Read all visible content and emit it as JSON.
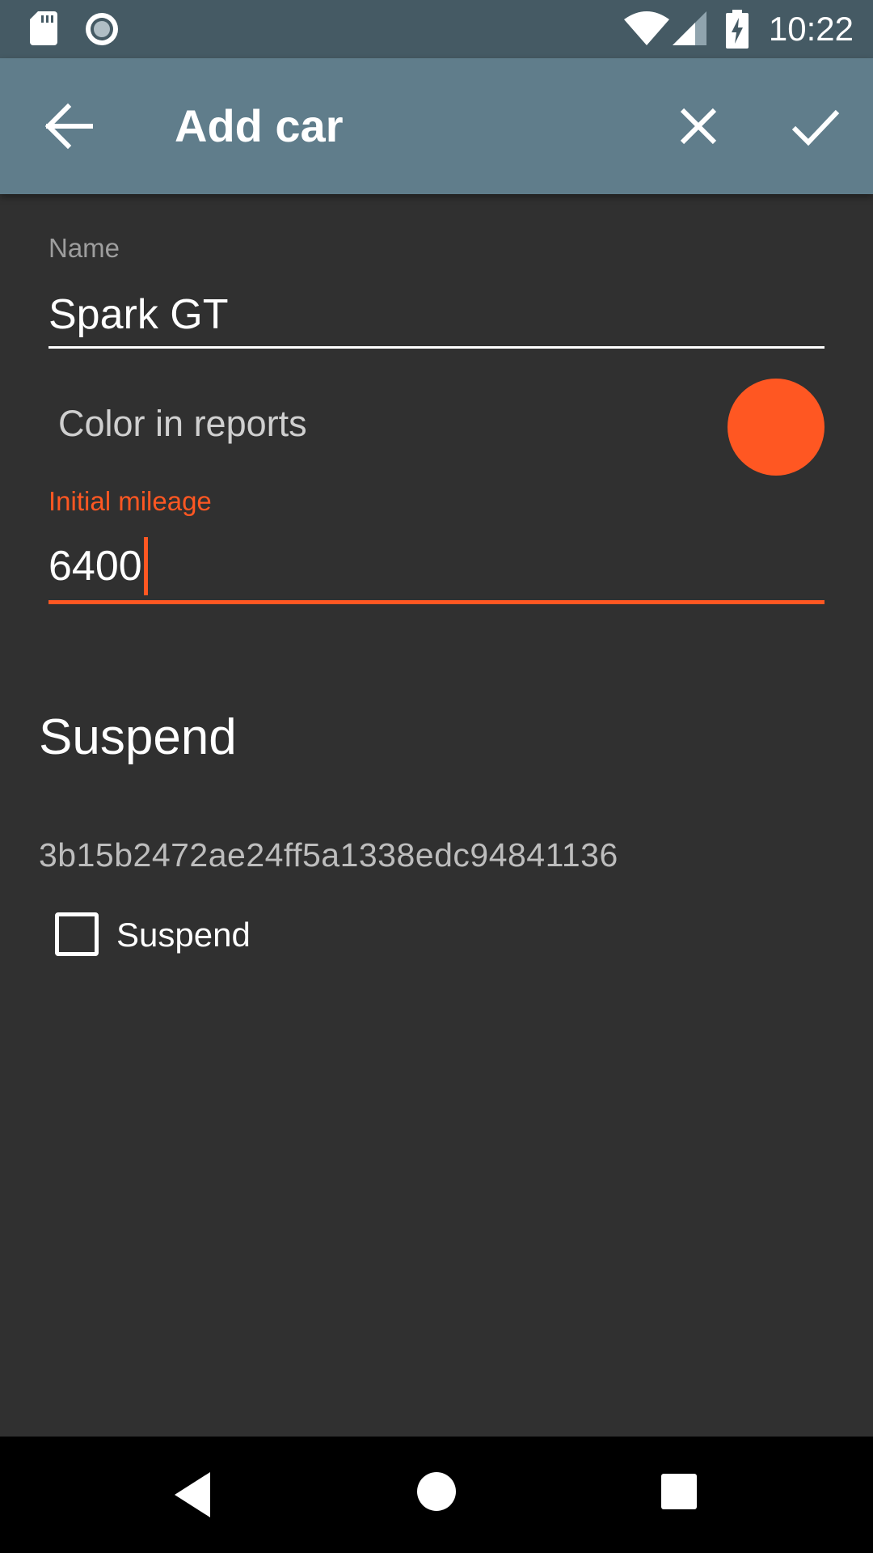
{
  "status_bar": {
    "time": "10:22",
    "icons": [
      "sd-card-icon",
      "sync-icon",
      "wifi-icon",
      "signal-icon",
      "battery-charging-icon"
    ]
  },
  "app_bar": {
    "title": "Add car",
    "icons": [
      "back-arrow-icon",
      "close-icon",
      "check-icon"
    ]
  },
  "form": {
    "name_label": "Name",
    "name_value": "Spark GT",
    "color_label": "Color in reports",
    "color_value": "#ff5722",
    "mileage_label": "Initial mileage",
    "mileage_value": "6400"
  },
  "suspend_section": {
    "title": "Suspend",
    "id_text": "3b15b2472ae24ff5a1338edc94841136",
    "checkbox_label": "Suspend",
    "checked": false
  },
  "colors": {
    "status_bar": "#455a64",
    "app_bar": "#607d8b",
    "background": "#303030",
    "accent": "#ff5722"
  },
  "nav_bar": {
    "icons": [
      "nav-back-icon",
      "nav-home-icon",
      "nav-recents-icon"
    ]
  }
}
